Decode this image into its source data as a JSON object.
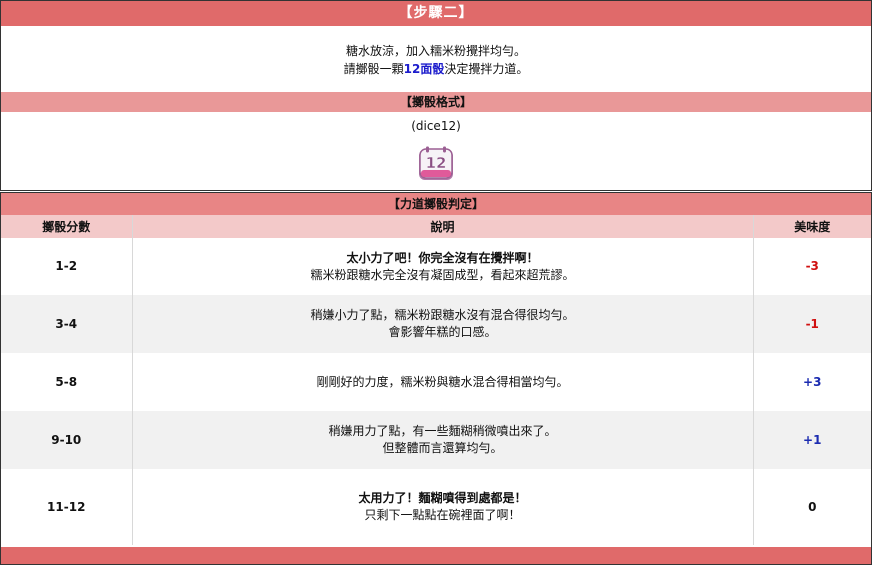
{
  "step": {
    "title": "【步驟二】",
    "line1": "糖水放涼，加入糯米粉攪拌均勻。",
    "line2_before": "請擲骰一顆",
    "line2_highlight": "12面骰",
    "line2_after": "決定攪拌力道。"
  },
  "format": {
    "title": "【擲骰格式】",
    "dice_text": "(dice12)",
    "icon_label": "12"
  },
  "judge": {
    "title": "【力道擲骰判定】",
    "columns": [
      "擲骰分數",
      "說明",
      "美味度"
    ],
    "rows": [
      {
        "score": "1-2",
        "desc_bold": "太小力了吧！你完全沒有在攪拌啊！",
        "desc": "糯米粉跟糖水完全沒有凝固成型，看起來超荒謬。",
        "taste": "-3"
      },
      {
        "score": "3-4",
        "desc_bold": "",
        "desc": "稍嫌小力了點，糯米粉跟糖水沒有混合得很均勻。",
        "desc2": "會影響年糕的口感。",
        "taste": "-1"
      },
      {
        "score": "5-8",
        "desc_bold": "",
        "desc": "剛剛好的力度，糯米粉與糖水混合得相當均勻。",
        "taste": "+3"
      },
      {
        "score": "9-10",
        "desc_bold": "",
        "desc": "稍嫌用力了點，有一些麵糊稍微噴出來了。",
        "desc2": "但整體而言還算均勻。",
        "taste": "+1"
      },
      {
        "score": "11-12",
        "desc_bold": "太用力了！麵糊噴得到處都是！",
        "desc": "只剩下一點點在碗裡面了啊！",
        "taste": "0"
      }
    ]
  },
  "colors": {
    "header_dark": "#e06a6a",
    "header_light": "#e99898",
    "negative": "#d01010",
    "positive": "#1b2bb0",
    "highlight": "#1c1ccc"
  }
}
